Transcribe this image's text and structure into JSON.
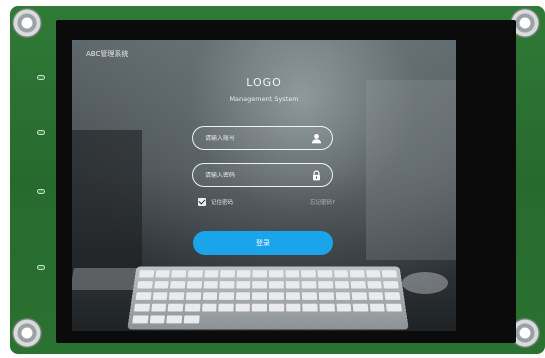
{
  "app": {
    "title": "ABC管理系统"
  },
  "login": {
    "logo": "LOGO",
    "subtitle": "Management System",
    "username_placeholder": "请输入账号",
    "password_placeholder": "请输入密码",
    "remember_label": "记住密码",
    "forgot_label": "忘记密码?",
    "remember_checked": true,
    "submit_label": "登录"
  },
  "icons": {
    "username": "user-icon",
    "password": "lock-icon"
  },
  "colors": {
    "board": "#2f7a36",
    "button": "#1aa5ea"
  }
}
